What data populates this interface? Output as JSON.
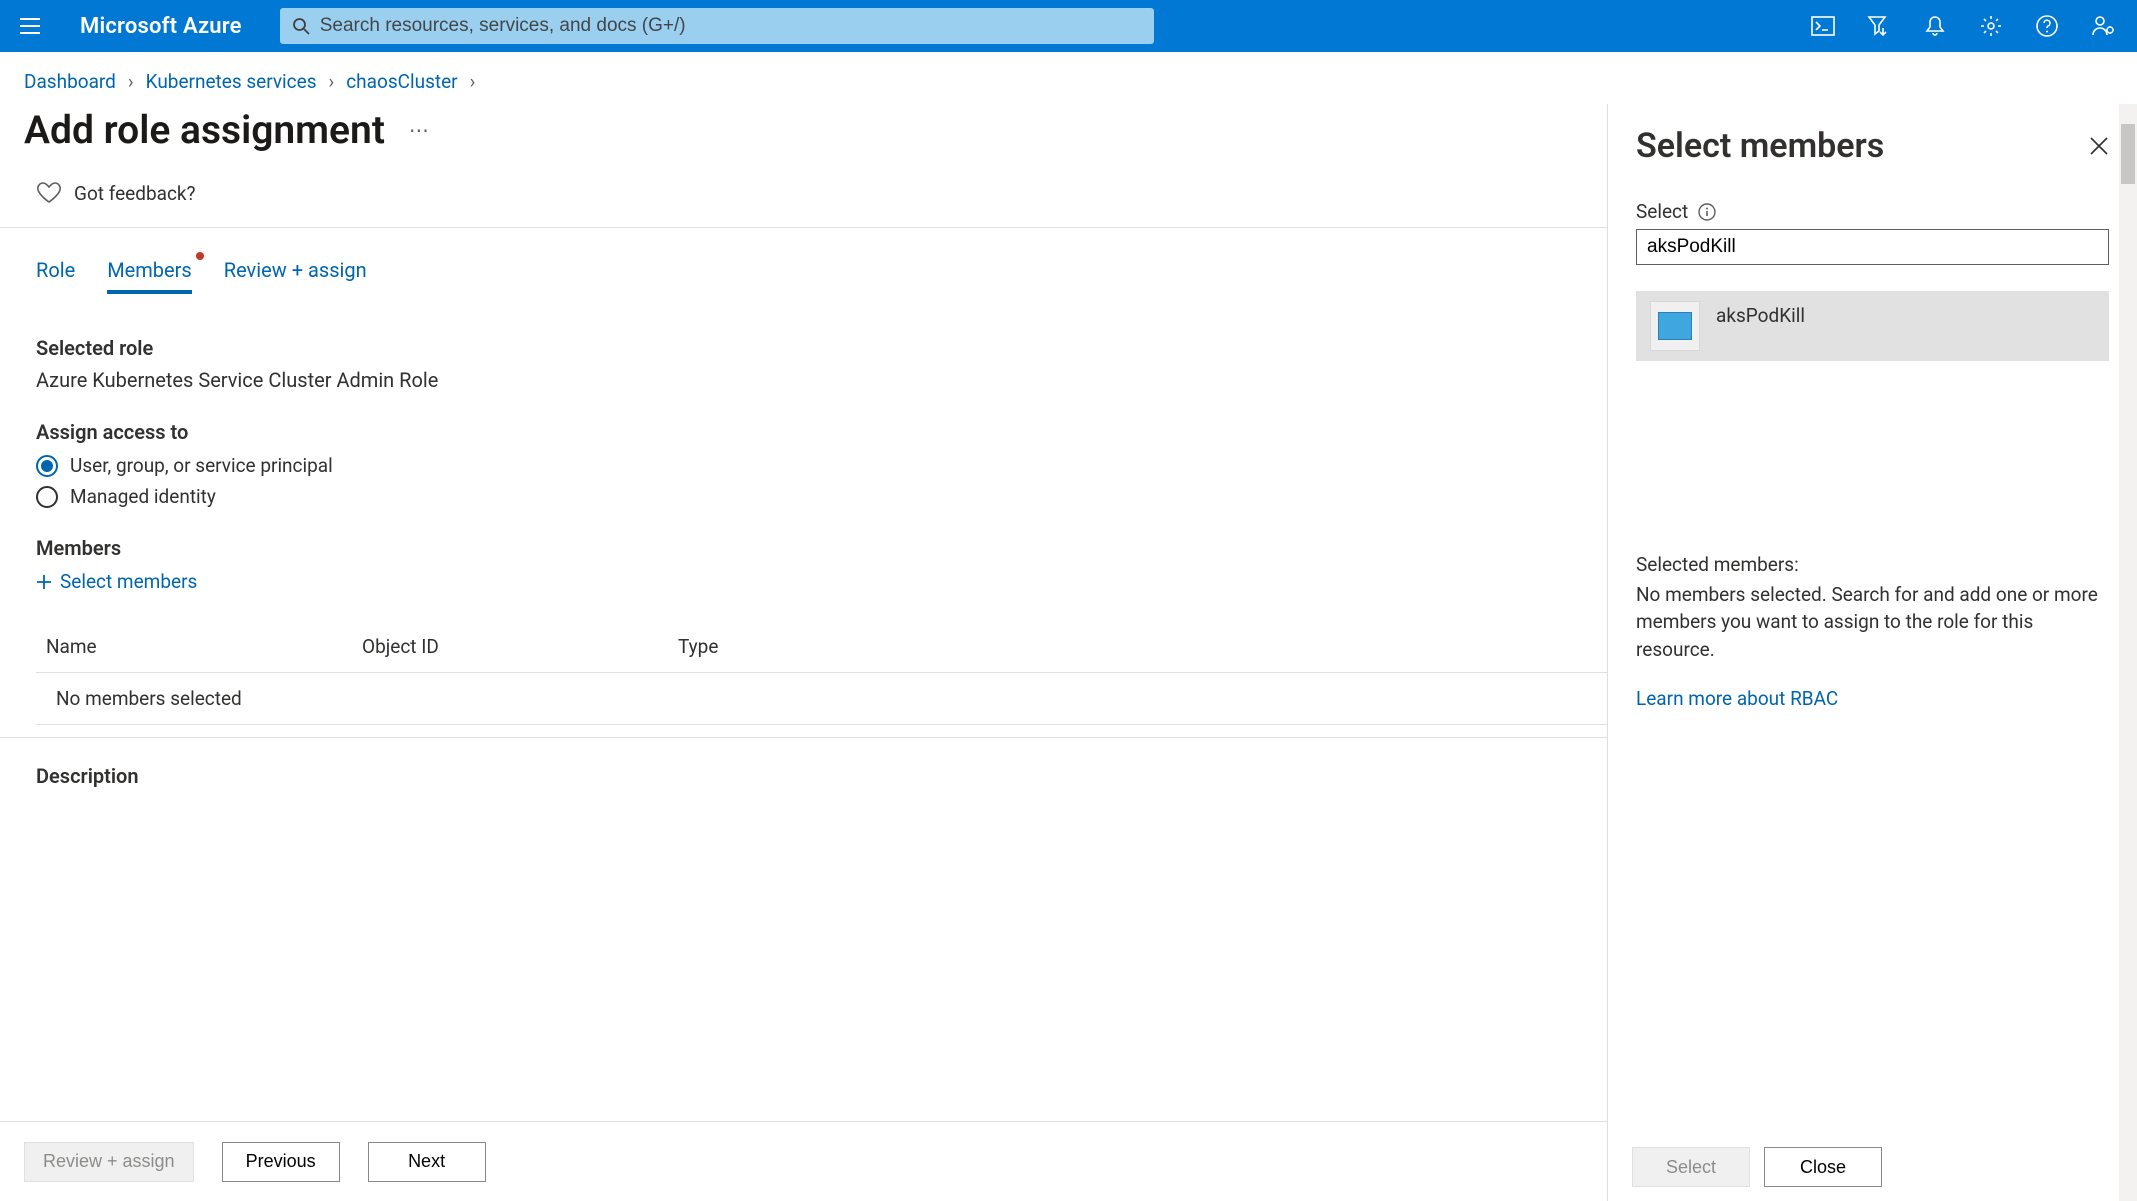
{
  "header": {
    "brand": "Microsoft Azure",
    "search_placeholder": "Search resources, services, and docs (G+/)"
  },
  "breadcrumbs": [
    "Dashboard",
    "Kubernetes services",
    "chaosCluster"
  ],
  "page_title": "Add role assignment",
  "feedback": "Got feedback?",
  "tabs": [
    {
      "label": "Role",
      "active": false,
      "indicator": false
    },
    {
      "label": "Members",
      "active": true,
      "indicator": true
    },
    {
      "label": "Review + assign",
      "active": false,
      "indicator": false
    }
  ],
  "selected_role": {
    "label": "Selected role",
    "value": "Azure Kubernetes Service Cluster Admin Role"
  },
  "assign_access": {
    "label": "Assign access to",
    "options": [
      {
        "label": "User, group, or service principal",
        "checked": true
      },
      {
        "label": "Managed identity",
        "checked": false
      }
    ]
  },
  "members": {
    "label": "Members",
    "add_link": "Select members",
    "columns": {
      "name": "Name",
      "object_id": "Object ID",
      "type": "Type"
    },
    "empty": "No members selected"
  },
  "description_label": "Description",
  "footer": {
    "review": "Review + assign",
    "previous": "Previous",
    "next": "Next"
  },
  "panel": {
    "title": "Select members",
    "select_label": "Select",
    "search_value": "aksPodKill",
    "result_name": "aksPodKill",
    "selected_heading": "Selected members:",
    "selected_text": "No members selected. Search for and add one or more members you want to assign to the role for this resource.",
    "learn_more": "Learn more about RBAC",
    "select_btn": "Select",
    "close_btn": "Close"
  }
}
